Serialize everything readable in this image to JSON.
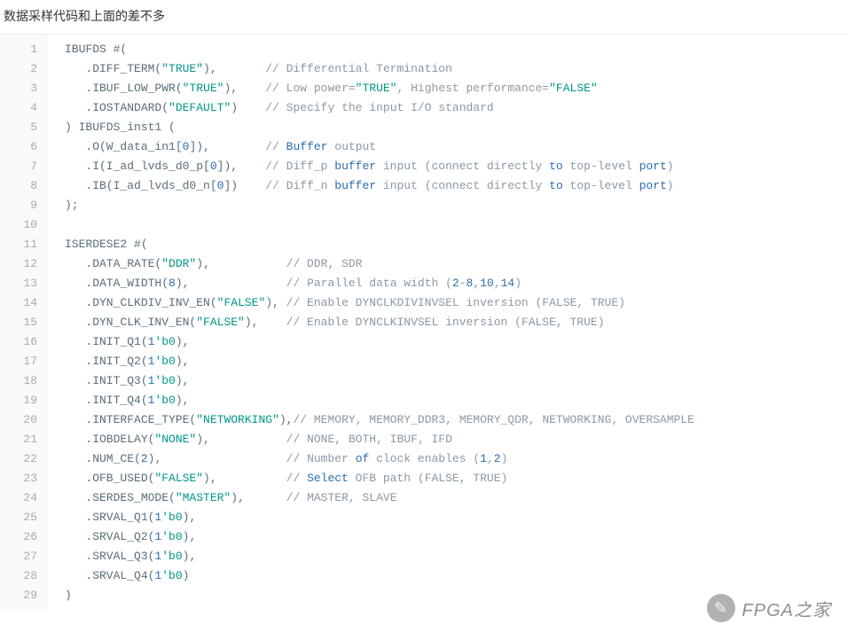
{
  "description": "数据采样代码和上面的差不多",
  "watermark": {
    "icon": "✎",
    "text": "FPGA之家"
  },
  "code": {
    "lines": [
      [
        {
          "t": "pln",
          "v": "IBUFDS #("
        }
      ],
      [
        {
          "t": "pln",
          "v": "   .DIFF_TERM("
        },
        {
          "t": "str",
          "v": "\"TRUE\""
        },
        {
          "t": "pln",
          "v": "),       "
        },
        {
          "t": "cmt",
          "v": "// Differential Termination"
        }
      ],
      [
        {
          "t": "pln",
          "v": "   .IBUF_LOW_PWR("
        },
        {
          "t": "str",
          "v": "\"TRUE\""
        },
        {
          "t": "pln",
          "v": "),    "
        },
        {
          "t": "cmt",
          "v": "// Low power="
        },
        {
          "t": "str",
          "v": "\"TRUE\""
        },
        {
          "t": "cmt",
          "v": ", Highest performance="
        },
        {
          "t": "str",
          "v": "\"FALSE\""
        }
      ],
      [
        {
          "t": "pln",
          "v": "   .IOSTANDARD("
        },
        {
          "t": "str",
          "v": "\"DEFAULT\""
        },
        {
          "t": "pln",
          "v": ")    "
        },
        {
          "t": "cmt",
          "v": "// Specify the input I/O standard"
        }
      ],
      [
        {
          "t": "pln",
          "v": ") IBUFDS_inst1 ("
        }
      ],
      [
        {
          "t": "pln",
          "v": "   .O(W_data_in1["
        },
        {
          "t": "num",
          "v": "0"
        },
        {
          "t": "pln",
          "v": "]),        "
        },
        {
          "t": "cmt",
          "v": "// "
        },
        {
          "t": "kw",
          "v": "Buffer"
        },
        {
          "t": "cmt",
          "v": " output"
        }
      ],
      [
        {
          "t": "pln",
          "v": "   .I(I_ad_lvds_d0_p["
        },
        {
          "t": "num",
          "v": "0"
        },
        {
          "t": "pln",
          "v": "]),    "
        },
        {
          "t": "cmt",
          "v": "// Diff_p "
        },
        {
          "t": "kw",
          "v": "buffer"
        },
        {
          "t": "cmt",
          "v": " input (connect directly "
        },
        {
          "t": "kw",
          "v": "to"
        },
        {
          "t": "cmt",
          "v": " top-level "
        },
        {
          "t": "kw",
          "v": "port"
        },
        {
          "t": "cmt",
          "v": ")"
        }
      ],
      [
        {
          "t": "pln",
          "v": "   .IB(I_ad_lvds_d0_n["
        },
        {
          "t": "num",
          "v": "0"
        },
        {
          "t": "pln",
          "v": "])    "
        },
        {
          "t": "cmt",
          "v": "// Diff_n "
        },
        {
          "t": "kw",
          "v": "buffer"
        },
        {
          "t": "cmt",
          "v": " input (connect directly "
        },
        {
          "t": "kw",
          "v": "to"
        },
        {
          "t": "cmt",
          "v": " top-level "
        },
        {
          "t": "kw",
          "v": "port"
        },
        {
          "t": "cmt",
          "v": ")"
        }
      ],
      [
        {
          "t": "pln",
          "v": ");"
        }
      ],
      [
        {
          "t": "pln",
          "v": ""
        }
      ],
      [
        {
          "t": "pln",
          "v": "ISERDESE2 #("
        }
      ],
      [
        {
          "t": "pln",
          "v": "   .DATA_RATE("
        },
        {
          "t": "str",
          "v": "\"DDR\""
        },
        {
          "t": "pln",
          "v": "),           "
        },
        {
          "t": "cmt",
          "v": "// DDR, SDR"
        }
      ],
      [
        {
          "t": "pln",
          "v": "   .DATA_WIDTH("
        },
        {
          "t": "num",
          "v": "8"
        },
        {
          "t": "pln",
          "v": "),              "
        },
        {
          "t": "cmt",
          "v": "// Parallel data width ("
        },
        {
          "t": "num",
          "v": "2"
        },
        {
          "t": "cmt",
          "v": "-"
        },
        {
          "t": "num",
          "v": "8"
        },
        {
          "t": "cmt",
          "v": ","
        },
        {
          "t": "num",
          "v": "10"
        },
        {
          "t": "cmt",
          "v": ","
        },
        {
          "t": "num",
          "v": "14"
        },
        {
          "t": "cmt",
          "v": ")"
        }
      ],
      [
        {
          "t": "pln",
          "v": "   .DYN_CLKDIV_INV_EN("
        },
        {
          "t": "str",
          "v": "\"FALSE\""
        },
        {
          "t": "pln",
          "v": "), "
        },
        {
          "t": "cmt",
          "v": "// Enable DYNCLKDIVINVSEL inversion (FALSE, TRUE)"
        }
      ],
      [
        {
          "t": "pln",
          "v": "   .DYN_CLK_INV_EN("
        },
        {
          "t": "str",
          "v": "\"FALSE\""
        },
        {
          "t": "pln",
          "v": "),    "
        },
        {
          "t": "cmt",
          "v": "// Enable DYNCLKINVSEL inversion (FALSE, TRUE)"
        }
      ],
      [
        {
          "t": "pln",
          "v": "   .INIT_Q1("
        },
        {
          "t": "num",
          "v": "1"
        },
        {
          "t": "str",
          "v": "'b0"
        },
        {
          "t": "pln",
          "v": "),"
        }
      ],
      [
        {
          "t": "pln",
          "v": "   .INIT_Q2("
        },
        {
          "t": "num",
          "v": "1"
        },
        {
          "t": "str",
          "v": "'b0"
        },
        {
          "t": "pln",
          "v": "),"
        }
      ],
      [
        {
          "t": "pln",
          "v": "   .INIT_Q3("
        },
        {
          "t": "num",
          "v": "1"
        },
        {
          "t": "str",
          "v": "'b0"
        },
        {
          "t": "pln",
          "v": "),"
        }
      ],
      [
        {
          "t": "pln",
          "v": "   .INIT_Q4("
        },
        {
          "t": "num",
          "v": "1"
        },
        {
          "t": "str",
          "v": "'b0"
        },
        {
          "t": "pln",
          "v": "),"
        }
      ],
      [
        {
          "t": "pln",
          "v": "   .INTERFACE_TYPE("
        },
        {
          "t": "str",
          "v": "\"NETWORKING\""
        },
        {
          "t": "pln",
          "v": "),"
        },
        {
          "t": "cmt",
          "v": "// MEMORY, MEMORY_DDR3, MEMORY_QDR, NETWORKING, OVERSAMPLE"
        }
      ],
      [
        {
          "t": "pln",
          "v": "   .IOBDELAY("
        },
        {
          "t": "str",
          "v": "\"NONE\""
        },
        {
          "t": "pln",
          "v": "),           "
        },
        {
          "t": "cmt",
          "v": "// NONE, BOTH, IBUF, IFD"
        }
      ],
      [
        {
          "t": "pln",
          "v": "   .NUM_CE("
        },
        {
          "t": "num",
          "v": "2"
        },
        {
          "t": "pln",
          "v": "),                  "
        },
        {
          "t": "cmt",
          "v": "// Number "
        },
        {
          "t": "kw",
          "v": "of"
        },
        {
          "t": "cmt",
          "v": " clock enables ("
        },
        {
          "t": "num",
          "v": "1"
        },
        {
          "t": "cmt",
          "v": ","
        },
        {
          "t": "num",
          "v": "2"
        },
        {
          "t": "cmt",
          "v": ")"
        }
      ],
      [
        {
          "t": "pln",
          "v": "   .OFB_USED("
        },
        {
          "t": "str",
          "v": "\"FALSE\""
        },
        {
          "t": "pln",
          "v": "),          "
        },
        {
          "t": "cmt",
          "v": "// "
        },
        {
          "t": "kw",
          "v": "Select"
        },
        {
          "t": "cmt",
          "v": " OFB path (FALSE, TRUE)"
        }
      ],
      [
        {
          "t": "pln",
          "v": "   .SERDES_MODE("
        },
        {
          "t": "str",
          "v": "\"MASTER\""
        },
        {
          "t": "pln",
          "v": "),      "
        },
        {
          "t": "cmt",
          "v": "// MASTER, SLAVE"
        }
      ],
      [
        {
          "t": "pln",
          "v": "   .SRVAL_Q1("
        },
        {
          "t": "num",
          "v": "1"
        },
        {
          "t": "str",
          "v": "'b0"
        },
        {
          "t": "pln",
          "v": "),"
        }
      ],
      [
        {
          "t": "pln",
          "v": "   .SRVAL_Q2("
        },
        {
          "t": "num",
          "v": "1"
        },
        {
          "t": "str",
          "v": "'b0"
        },
        {
          "t": "pln",
          "v": "),"
        }
      ],
      [
        {
          "t": "pln",
          "v": "   .SRVAL_Q3("
        },
        {
          "t": "num",
          "v": "1"
        },
        {
          "t": "str",
          "v": "'b0"
        },
        {
          "t": "pln",
          "v": "),"
        }
      ],
      [
        {
          "t": "pln",
          "v": "   .SRVAL_Q4("
        },
        {
          "t": "num",
          "v": "1"
        },
        {
          "t": "str",
          "v": "'b0"
        },
        {
          "t": "pln",
          "v": ")"
        }
      ],
      [
        {
          "t": "pln",
          "v": ")"
        }
      ]
    ]
  }
}
